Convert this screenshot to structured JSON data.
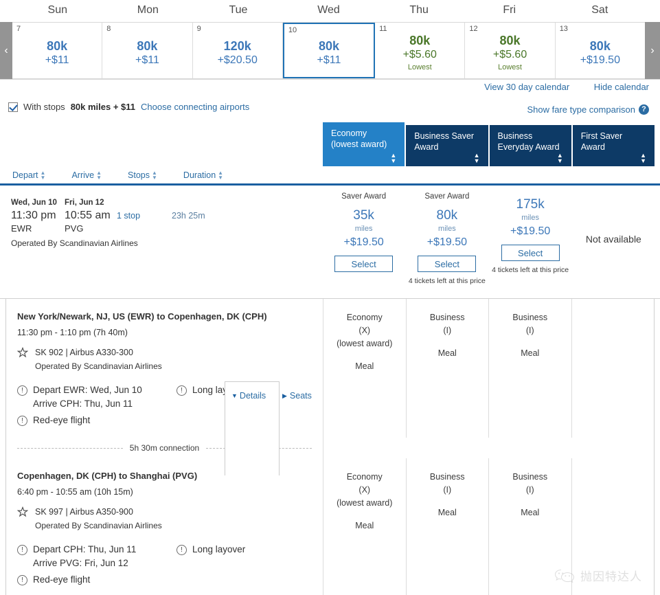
{
  "calendar": {
    "weekdays": [
      "Sun",
      "Mon",
      "Tue",
      "Wed",
      "Thu",
      "Fri",
      "Sat"
    ],
    "prev_arrow": "‹",
    "next_arrow": "›",
    "days": [
      {
        "day": "7",
        "miles": "80k",
        "price": "+$11",
        "lowest": "",
        "selected": false,
        "is_lowest": false
      },
      {
        "day": "8",
        "miles": "80k",
        "price": "+$11",
        "lowest": "",
        "selected": false,
        "is_lowest": false
      },
      {
        "day": "9",
        "miles": "120k",
        "price": "+$20.50",
        "lowest": "",
        "selected": false,
        "is_lowest": false
      },
      {
        "day": "10",
        "miles": "80k",
        "price": "+$11",
        "lowest": "",
        "selected": true,
        "is_lowest": false
      },
      {
        "day": "11",
        "miles": "80k",
        "price": "+$5.60",
        "lowest": "Lowest",
        "selected": false,
        "is_lowest": true
      },
      {
        "day": "12",
        "miles": "80k",
        "price": "+$5.60",
        "lowest": "Lowest",
        "selected": false,
        "is_lowest": true
      },
      {
        "day": "13",
        "miles": "80k",
        "price": "+$19.50",
        "lowest": "",
        "selected": false,
        "is_lowest": false
      }
    ]
  },
  "links": {
    "view_30_day": "View 30 day calendar",
    "hide_calendar": "Hide calendar",
    "fare_comparison": "Show fare type comparison",
    "help_glyph": "?"
  },
  "stops_bar": {
    "label": "With stops",
    "amount": "80k miles + $11",
    "choose_airports": "Choose connecting airports"
  },
  "fare_columns": [
    {
      "line1": "Economy",
      "line2": "(lowest award)",
      "active": true
    },
    {
      "line1": "Business Saver",
      "line2": "Award",
      "active": false
    },
    {
      "line1": "Business",
      "line2": "Everyday Award",
      "active": false
    },
    {
      "line1": "First Saver Award",
      "line2": "",
      "active": false
    }
  ],
  "sort_bar": {
    "items": [
      "Depart",
      "Arrive",
      "Stops",
      "Duration"
    ]
  },
  "flight": {
    "depart_date": "Wed, Jun 10",
    "depart_time": "11:30 pm",
    "depart_code": "EWR",
    "arrive_date": "Fri, Jun 12",
    "arrive_time": "10:55 am",
    "arrive_code": "PVG",
    "stops": "1 stop",
    "duration": "23h 25m",
    "operated_by": "Operated By Scandinavian Airlines",
    "details_label": "Details",
    "seats_label": "Seats"
  },
  "fares": [
    {
      "saver_label": "Saver Award",
      "miles": "35k",
      "miles_word": "miles",
      "cash": "+$19.50",
      "select": "Select",
      "tickets_left": "",
      "available": true
    },
    {
      "saver_label": "Saver Award",
      "miles": "80k",
      "miles_word": "miles",
      "cash": "+$19.50",
      "select": "Select",
      "tickets_left": "4 tickets left at this price",
      "available": true
    },
    {
      "saver_label": "",
      "miles": "175k",
      "miles_word": "miles",
      "cash": "+$19.50",
      "select": "Select",
      "tickets_left": "4 tickets left at this price",
      "available": true
    },
    {
      "saver_label": "",
      "miles": "",
      "miles_word": "",
      "cash": "",
      "select": "",
      "tickets_left": "",
      "available": false,
      "not_available_label": "Not available"
    }
  ],
  "segments": [
    {
      "title": "New York/Newark, NJ, US (EWR) to Copenhagen, DK (CPH)",
      "times": "11:30 pm - 1:10 pm (7h 40m)",
      "flight_no": "SK 902 | Airbus A330-300",
      "operated_by": "Operated By Scandinavian Airlines",
      "note_depart": "Depart EWR: Wed, Jun 10",
      "note_arrive": "Arrive CPH: Thu, Jun 11",
      "note_layover": "Long layover",
      "note_redeye": "Red-eye flight",
      "cabins": [
        {
          "name": "Economy",
          "code": "(X)",
          "extra": "(lowest award)",
          "meal": "Meal"
        },
        {
          "name": "Business",
          "code": "(I)",
          "extra": "",
          "meal": "Meal"
        },
        {
          "name": "Business",
          "code": "(I)",
          "extra": "",
          "meal": "Meal"
        },
        {
          "name": "",
          "code": "",
          "extra": "",
          "meal": ""
        }
      ]
    },
    {
      "title": "Copenhagen, DK (CPH) to Shanghai (PVG)",
      "times": "6:40 pm - 10:55 am (10h 15m)",
      "flight_no": "SK 997 | Airbus A350-900",
      "operated_by": "Operated By Scandinavian Airlines",
      "note_depart": "Depart CPH: Thu, Jun 11",
      "note_arrive": "Arrive PVG: Fri, Jun 12",
      "note_layover": "Long layover",
      "note_redeye": "Red-eye flight",
      "cabins": [
        {
          "name": "Economy",
          "code": "(X)",
          "extra": "(lowest award)",
          "meal": "Meal"
        },
        {
          "name": "Business",
          "code": "(I)",
          "extra": "",
          "meal": "Meal"
        },
        {
          "name": "Business",
          "code": "(I)",
          "extra": "",
          "meal": "Meal"
        },
        {
          "name": "",
          "code": "",
          "extra": "",
          "meal": ""
        }
      ]
    }
  ],
  "connection": {
    "text": "5h 30m connection"
  },
  "watermark": {
    "text": "抛因特达人"
  },
  "icons": {
    "excl": "!",
    "sort_up_down": "▲▼"
  },
  "colors": {
    "brand_blue": "#2b6ca3",
    "header_navy": "#0d3a66",
    "header_active": "#2481c7",
    "lowest_green": "#4a7729",
    "link_blue": "#3c77b8"
  }
}
